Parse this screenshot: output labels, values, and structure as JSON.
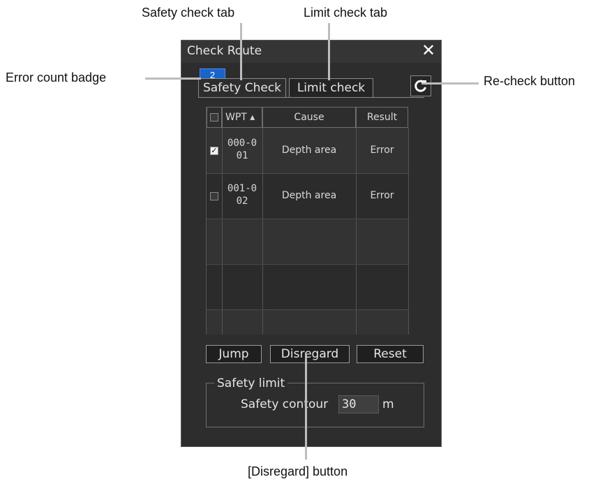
{
  "callouts": {
    "safety_tab": "Safety check tab",
    "limit_tab": "Limit check tab",
    "error_badge": "Error count badge",
    "recheck": "Re-check button",
    "disregard": "[Disregard] button"
  },
  "dialog": {
    "title": "Check Route",
    "close_glyph": "✕",
    "badge_count": "2",
    "tabs": {
      "safety": "Safety Check",
      "limit": "Limit check"
    },
    "recheck_icon": "refresh-icon"
  },
  "table": {
    "headers": {
      "wpt": "WPT ▴",
      "cause": "Cause",
      "result": "Result"
    },
    "rows": [
      {
        "checked": true,
        "wpt_line1": "000-0",
        "wpt_line2": "01",
        "cause": "Depth area",
        "result": "Error"
      },
      {
        "checked": false,
        "wpt_line1": "001-0",
        "wpt_line2": "02",
        "cause": "Depth area",
        "result": "Error"
      }
    ]
  },
  "buttons": {
    "jump": "Jump",
    "disregard": "Disregard",
    "reset": "Reset"
  },
  "safety_limit": {
    "legend": "Safety limit",
    "label": "Safety contour",
    "value": "30",
    "unit": "m"
  },
  "colors": {
    "dialog_bg": "#2d2d2d",
    "badge": "#1a63c9",
    "leader_line": "#bdbdbd"
  }
}
